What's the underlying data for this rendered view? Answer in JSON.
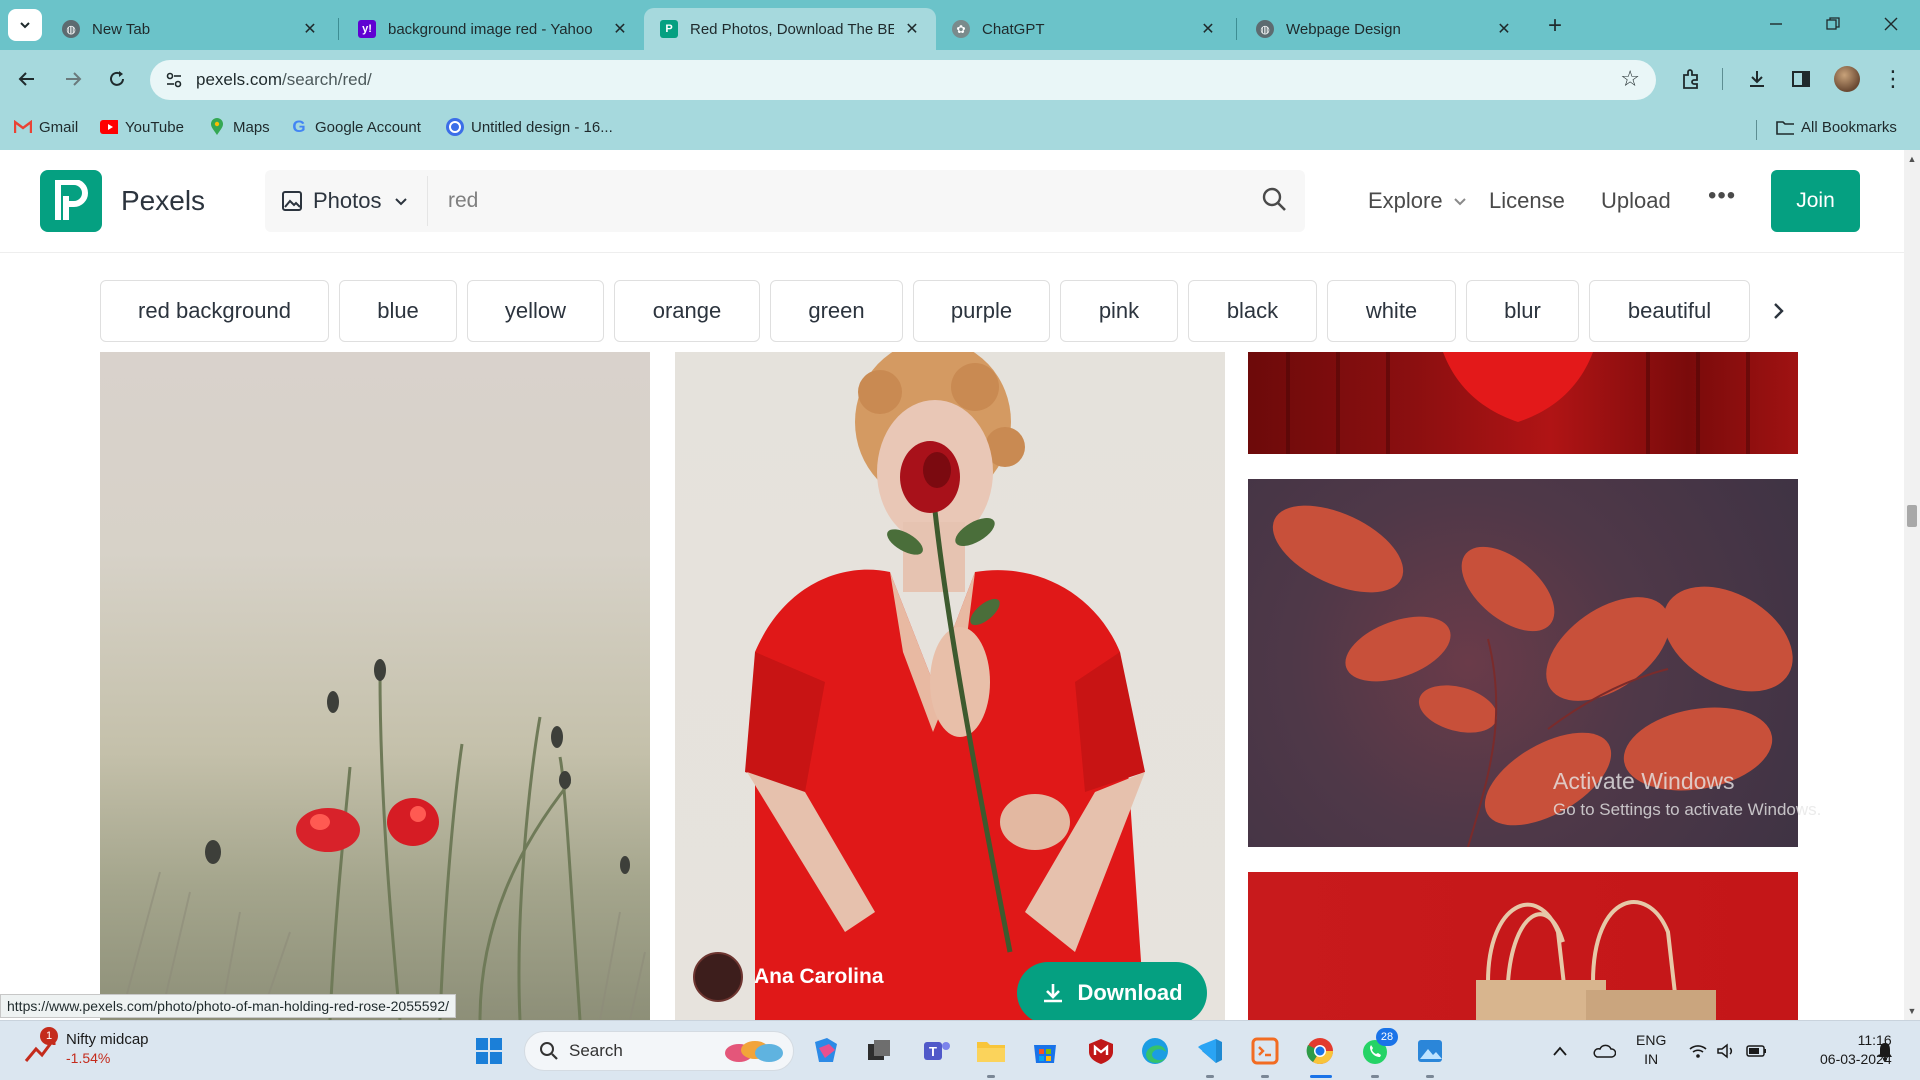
{
  "browser": {
    "tabs": [
      {
        "title": "New Tab",
        "icon": "globe-icon"
      },
      {
        "title": "background image red - Yahoo",
        "icon": "yahoo-icon"
      },
      {
        "title": "Red Photos, Download The BEST",
        "icon": "pexels-icon",
        "active": true
      },
      {
        "title": "ChatGPT",
        "icon": "chatgpt-icon"
      },
      {
        "title": "Webpage Design",
        "icon": "globe-icon"
      }
    ],
    "url_host": "pexels.com",
    "url_path": "/search/red/",
    "bookmarks": [
      {
        "label": "Gmail",
        "icon": "gmail-icon"
      },
      {
        "label": "YouTube",
        "icon": "youtube-icon"
      },
      {
        "label": "Maps",
        "icon": "maps-icon"
      },
      {
        "label": "Google Account",
        "icon": "google-icon"
      },
      {
        "label": "Untitled design - 16...",
        "icon": "canva-icon"
      }
    ],
    "all_bookmarks": "All Bookmarks",
    "status_url": "https://www.pexels.com/photo/photo-of-man-holding-red-rose-2055592/"
  },
  "site": {
    "brand": "Pexels",
    "search_type": "Photos",
    "search_query": "red",
    "nav": {
      "explore": "Explore",
      "license": "License",
      "upload": "Upload",
      "more": "•••",
      "join": "Join"
    },
    "chips": [
      "red background",
      "blue",
      "yellow",
      "orange",
      "green",
      "purple",
      "pink",
      "black",
      "white",
      "blur",
      "beautiful"
    ],
    "featured_photo": {
      "photographer": "Ana Carolina",
      "download_label": "Download"
    },
    "colors": {
      "brand_green": "#05a081"
    }
  },
  "overlay": {
    "activate_title": "Activate Windows",
    "activate_sub": "Go to Settings to activate Windows."
  },
  "taskbar": {
    "widget_title": "Nifty midcap",
    "widget_value": "-1.54%",
    "widget_badge": "1",
    "search_label": "Search",
    "whatsapp_badge": "28",
    "lang": "ENG",
    "region": "IN",
    "time": "11:16",
    "date": "06-03-2024"
  }
}
